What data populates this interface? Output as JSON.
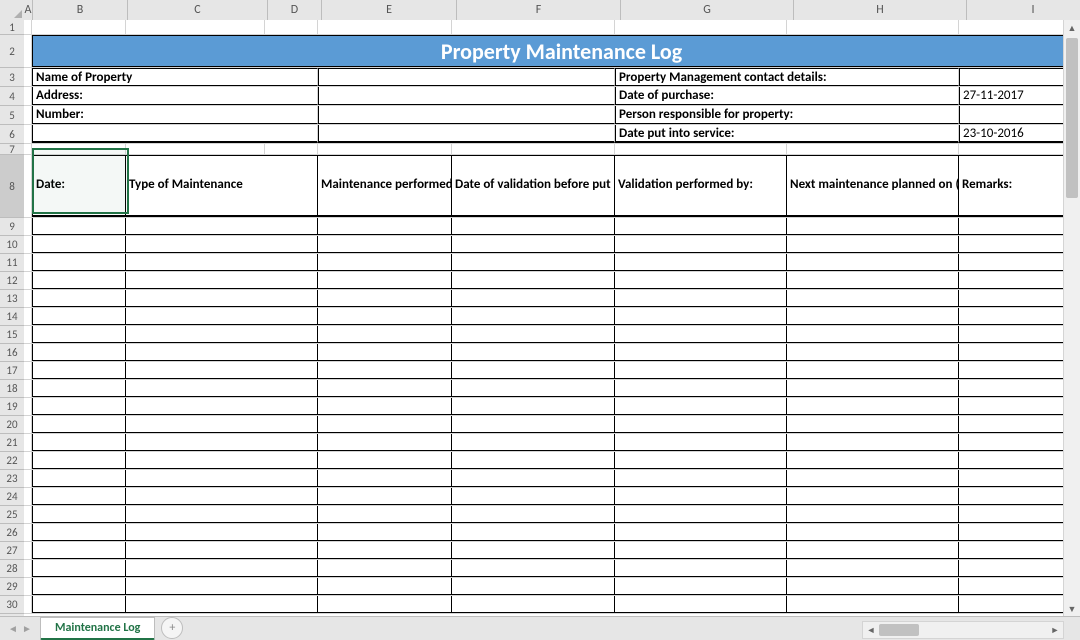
{
  "columns": [
    "A",
    "B",
    "C",
    "D",
    "E",
    "F",
    "G",
    "H",
    "I"
  ],
  "rowNumbers": [
    1,
    2,
    3,
    4,
    5,
    6,
    7,
    8,
    9,
    10,
    11,
    12,
    13,
    14,
    15,
    16,
    17,
    18,
    19,
    20,
    21,
    22,
    23,
    24,
    25,
    26,
    27,
    28,
    29,
    30
  ],
  "selectedRow": 8,
  "title": "Property Maintenance Log",
  "info": {
    "nameOfProperty_label": "Name of Property",
    "address_label": "Address:",
    "number_label": "Number:",
    "mgmtContact_label": "Property Management contact details:",
    "dateOfPurchase_label": "Date of purchase:",
    "dateOfPurchase_value": "27-11-2017",
    "personResp_label": "Person responsible for property:",
    "datePutService_label": "Date put into service:",
    "datePutService_value": "23-10-2016"
  },
  "tableHeaders": {
    "date": "Date:",
    "type": "Type of Maintenance",
    "performedBy": "Maintenance performed by:",
    "validationDate": "Date of validation before put into service:",
    "validationBy": "Validation performed by:",
    "nextPlanned": "Next maintenance planned on (date):",
    "remarks": "Remarks:"
  },
  "sheetTab": "Maintenance Log",
  "blankRows": 22
}
